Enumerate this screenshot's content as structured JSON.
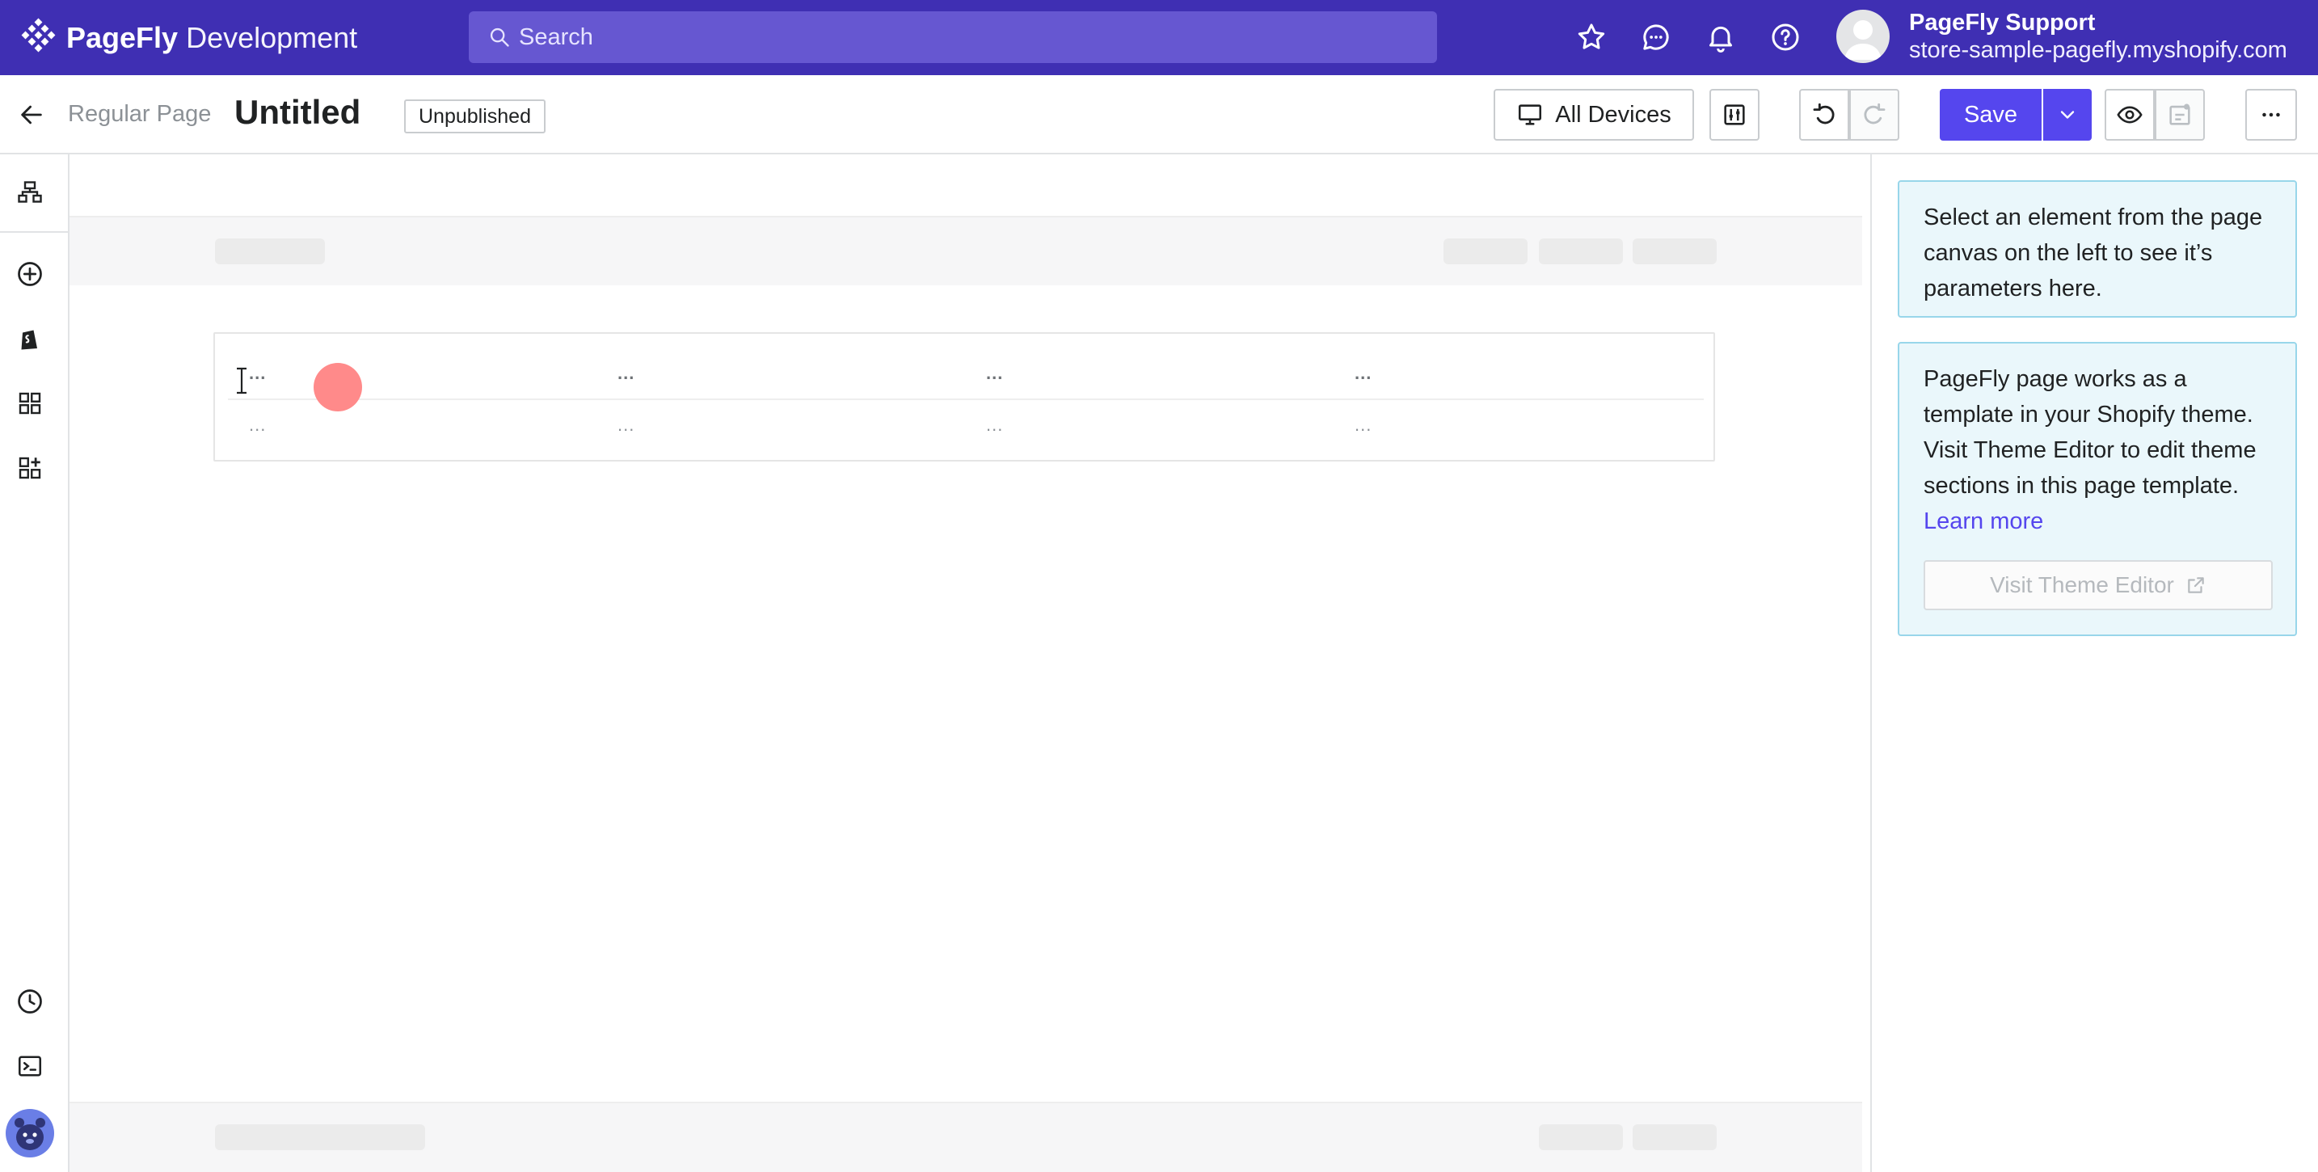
{
  "app": {
    "brand_bold": "PageFly",
    "brand_light": " Development"
  },
  "search": {
    "placeholder": "Search"
  },
  "user": {
    "name": "PageFly Support",
    "store": "store-sample-pagefly.myshopify.com"
  },
  "toolbar": {
    "breadcrumb": "Regular Page",
    "title": "Untitled",
    "status": "Unpublished",
    "devices_label": "All Devices",
    "save_label": "Save"
  },
  "table": {
    "headers": [
      "...",
      "...",
      "...",
      "..."
    ],
    "rows": [
      [
        "...",
        "...",
        "...",
        "..."
      ]
    ]
  },
  "right_panel": {
    "select_hint": "Select an element from the page canvas on the left to see it’s parameters here.",
    "template_info": "PageFly page works as a template in your Shopify theme. Visit Theme Editor to edit theme sections in this page template.",
    "learn_more": "Learn more",
    "theme_editor_button": "Visit Theme Editor"
  },
  "colors": {
    "topbar": "#3f2fb3",
    "primary": "#5546ee",
    "info_bg": "#eaf7fb",
    "info_border": "#98d6ea",
    "click_marker": "#ff8a8a"
  },
  "icons": {
    "topbar": [
      "star-icon",
      "chat-icon",
      "bell-icon",
      "help-icon"
    ],
    "sidebar": [
      "layers-icon",
      "add-icon",
      "shopify-icon",
      "grid-icon",
      "add-section-icon",
      "history-icon",
      "terminal-icon"
    ]
  }
}
